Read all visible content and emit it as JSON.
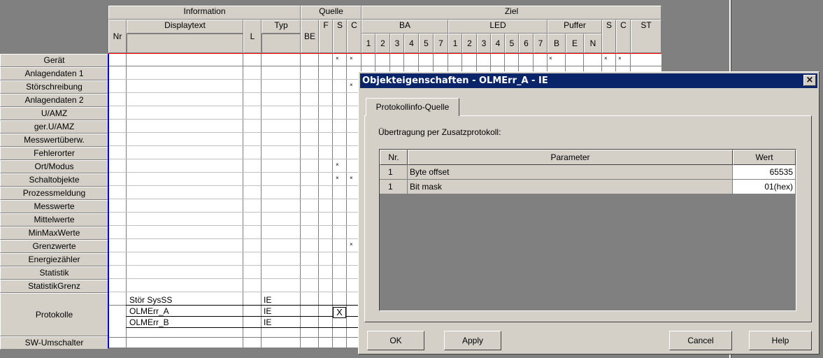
{
  "headers": {
    "information": "Information",
    "quelle": "Quelle",
    "ziel": "Ziel",
    "nr": "Nr",
    "displaytext": "Displaytext",
    "l": "L",
    "typ": "Typ",
    "be": "BE",
    "f": "F",
    "s": "S",
    "c": "C",
    "ba": "BA",
    "led": "LED",
    "puffer": "Puffer",
    "s2": "S",
    "c2": "C",
    "st": "ST",
    "ba_cols": [
      "1",
      "2",
      "3",
      "4",
      "5",
      "7"
    ],
    "led_cols": [
      "1",
      "2",
      "3",
      "4",
      "5",
      "6",
      "7"
    ],
    "puffer_cols": [
      "B",
      "E",
      "N"
    ]
  },
  "rows": [
    "Gerät",
    "Anlagendaten 1",
    "Störschreibung",
    "Anlagendaten 2",
    "U/AMZ",
    "ger.U/AMZ",
    "Messwertüberw.",
    "Fehlerorter",
    "Ort/Modus",
    "Schaltobjekte",
    "Prozessmeldung",
    "Messwerte",
    "Mittelwerte",
    "MinMaxWerte",
    "Grenzwerte",
    "Energiezähler",
    "Statistik",
    "StatistikGrenz",
    "Protokolle",
    "SW-Umschalter"
  ],
  "protokolle_entries": [
    {
      "displaytext": "Stör SysSS",
      "typ": "IE"
    },
    {
      "displaytext": "OLMErr_A",
      "typ": "IE"
    },
    {
      "displaytext": "OLMErr_B",
      "typ": "IE"
    }
  ],
  "checkbox_mark": "X",
  "cell_mark": "×",
  "dialog": {
    "title": "Objekteigenschaften - OLMErr_A - IE",
    "close": "×",
    "tab": "Protokollinfo-Quelle",
    "caption": "Übertragung per Zusatzprotokoll:",
    "columns": {
      "nr": "Nr.",
      "parameter": "Parameter",
      "wert": "Wert"
    },
    "rows": [
      {
        "nr": "1",
        "parameter": "Byte offset",
        "wert": "65535"
      },
      {
        "nr": "1",
        "parameter": "Bit mask",
        "wert": "01(hex)"
      }
    ],
    "buttons": {
      "ok": "OK",
      "apply": "Apply",
      "cancel": "Cancel",
      "help": "Help"
    }
  },
  "colors": {
    "accent": "#0a246a",
    "face": "#d4d0c8",
    "gridline_red": "#ff0000",
    "row_blue": "#0000ff"
  }
}
